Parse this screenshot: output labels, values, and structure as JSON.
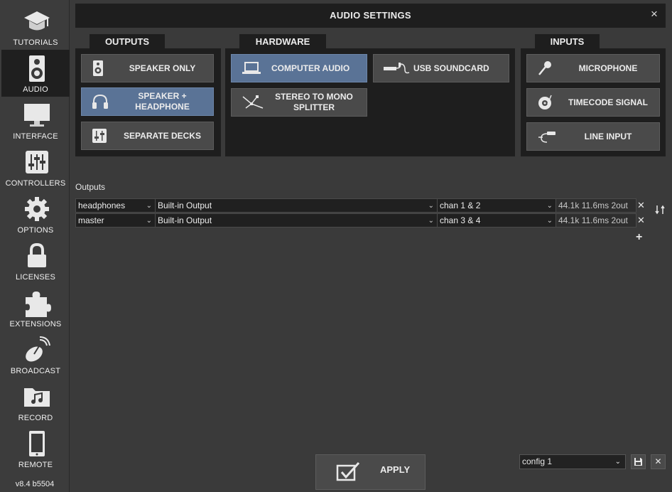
{
  "window": {
    "title": "AUDIO SETTINGS",
    "close_glyph": "×"
  },
  "sidebar": {
    "items": [
      {
        "label": "TUTORIALS",
        "icon": "graduation-cap-icon"
      },
      {
        "label": "AUDIO",
        "icon": "speaker-icon",
        "active": true
      },
      {
        "label": "INTERFACE",
        "icon": "monitor-icon"
      },
      {
        "label": "CONTROLLERS",
        "icon": "mixer-sliders-icon"
      },
      {
        "label": "OPTIONS",
        "icon": "gear-icon"
      },
      {
        "label": "LICENSES",
        "icon": "lock-icon"
      },
      {
        "label": "EXTENSIONS",
        "icon": "puzzle-icon"
      },
      {
        "label": "BROADCAST",
        "icon": "satellite-dish-icon"
      },
      {
        "label": "RECORD",
        "icon": "music-folder-icon"
      },
      {
        "label": "REMOTE",
        "icon": "tablet-icon"
      }
    ],
    "version": "v8.4 b5504"
  },
  "outputs_panel": {
    "tab": "OUTPUTS",
    "buttons": [
      {
        "label": "SPEAKER ONLY",
        "icon": "speaker-icon",
        "selected": false
      },
      {
        "label": "SPEAKER + HEADPHONE",
        "icon": "headphones-icon",
        "selected": true
      },
      {
        "label": "SEPARATE DECKS",
        "icon": "decks-icon",
        "selected": false
      }
    ]
  },
  "hardware_panel": {
    "tab": "HARDWARE",
    "buttons": [
      {
        "label": "COMPUTER AUDIO",
        "icon": "laptop-icon",
        "selected": true
      },
      {
        "label": "USB SOUNDCARD",
        "icon": "usb-cable-icon",
        "selected": false
      },
      {
        "label": "STEREO TO MONO SPLITTER",
        "icon": "splitter-cable-icon",
        "selected": false
      }
    ]
  },
  "inputs_panel": {
    "tab": "INPUTS",
    "buttons": [
      {
        "label": "MICROPHONE",
        "icon": "microphone-icon",
        "selected": false
      },
      {
        "label": "TIMECODE SIGNAL",
        "icon": "turntable-icon",
        "selected": false
      },
      {
        "label": "LINE INPUT",
        "icon": "rca-cable-icon",
        "selected": false
      }
    ]
  },
  "outputs_table": {
    "label": "Outputs",
    "rows": [
      {
        "name": "headphones",
        "device": "Built-in Output",
        "channels": "chan 1 & 2",
        "info": "44.1k 11.6ms 2out"
      },
      {
        "name": "master",
        "device": "Built-in Output",
        "channels": "chan 3 & 4",
        "info": "44.1k 11.6ms 2out"
      }
    ],
    "remove_glyph": "✕",
    "add_glyph": "+",
    "dropdown_glyph": "⌄"
  },
  "footer": {
    "apply_label": "APPLY",
    "config_value": "config 1",
    "delete_glyph": "✕"
  },
  "colors": {
    "background": "#3a3a3a",
    "panel": "#1e1e1e",
    "button": "#4a4a4a",
    "selected_button": "#5a7396"
  }
}
